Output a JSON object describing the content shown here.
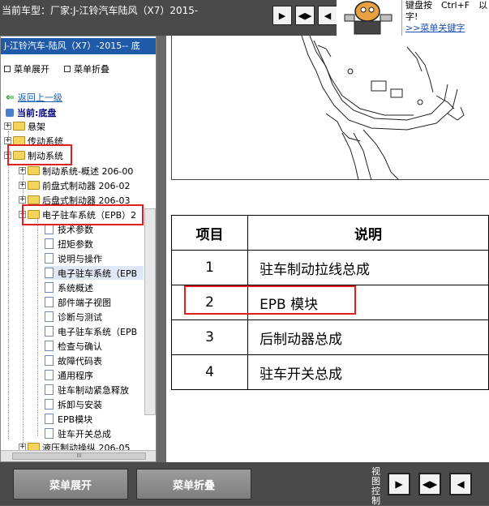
{
  "window": {
    "title": "当前车型：厂家:J-江铃汽车陆风（X7）2015-"
  },
  "top_nav": {
    "buttons": [
      "▶",
      "◀▶",
      "◀"
    ]
  },
  "tip": {
    "line1": "键盘按　Ctrl+F　以",
    "line2": "字!",
    "link": ">>菜单关键字"
  },
  "left_panel": {
    "header": "J-江铃汽车-陆风（X7）-2015-- 底",
    "expand_label": "菜单展开",
    "collapse_label": "菜单折叠",
    "back_label": "返回上一级",
    "current_label": "当前:底盘",
    "tree": [
      {
        "label": "悬架",
        "type": "folder",
        "pm": "+"
      },
      {
        "label": "传动系统",
        "type": "folder",
        "pm": "+"
      },
      {
        "label": "制动系统",
        "type": "folder",
        "pm": "−"
      },
      {
        "label": "制动系统-概述 206-00",
        "type": "folder",
        "pm": "+"
      },
      {
        "label": "前盘式制动器 206-02",
        "type": "folder",
        "pm": "+"
      },
      {
        "label": "后盘式制动器 206-03",
        "type": "folder",
        "pm": "+"
      },
      {
        "label": "电子驻车系统（EPB）2",
        "type": "folder",
        "pm": "−"
      },
      {
        "label": "技术参数",
        "type": "doc"
      },
      {
        "label": "扭矩参数",
        "type": "doc"
      },
      {
        "label": "说明与操作",
        "type": "doc"
      },
      {
        "label": "电子驻车系统（EPB",
        "type": "doc",
        "selected": true
      },
      {
        "label": "系统概述",
        "type": "doc"
      },
      {
        "label": "部件端子视图",
        "type": "doc"
      },
      {
        "label": "诊断与测试",
        "type": "doc"
      },
      {
        "label": "电子驻车系统（EPB",
        "type": "doc"
      },
      {
        "label": "检查与确认",
        "type": "doc"
      },
      {
        "label": "故障代码表",
        "type": "doc"
      },
      {
        "label": "通用程序",
        "type": "doc"
      },
      {
        "label": "驻车制动紧急释放",
        "type": "doc"
      },
      {
        "label": "拆卸与安装",
        "type": "doc"
      },
      {
        "label": "EPB模块",
        "type": "doc"
      },
      {
        "label": "驻车开关总成",
        "type": "doc"
      },
      {
        "label": "液压制动操纵 206-05",
        "type": "folder",
        "pm": "+"
      }
    ],
    "hscroll_grip": "III"
  },
  "parts_table": {
    "headers": [
      "项目",
      "说明"
    ],
    "rows": [
      {
        "num": "1",
        "desc": "驻车制动拉线总成"
      },
      {
        "num": "2",
        "desc": "EPB 模块"
      },
      {
        "num": "3",
        "desc": "后制动器总成"
      },
      {
        "num": "4",
        "desc": "驻车开关总成"
      }
    ]
  },
  "bottom_bar": {
    "expand_label": "菜单展开",
    "collapse_label": "菜单折叠",
    "view_label": "视图控制",
    "view_buttons": [
      "▶",
      "◀▶",
      "◀"
    ]
  },
  "colors": {
    "highlight_box": "#e02020",
    "header_blue": "#1e5aa8",
    "link_blue": "#1a5fb0"
  }
}
